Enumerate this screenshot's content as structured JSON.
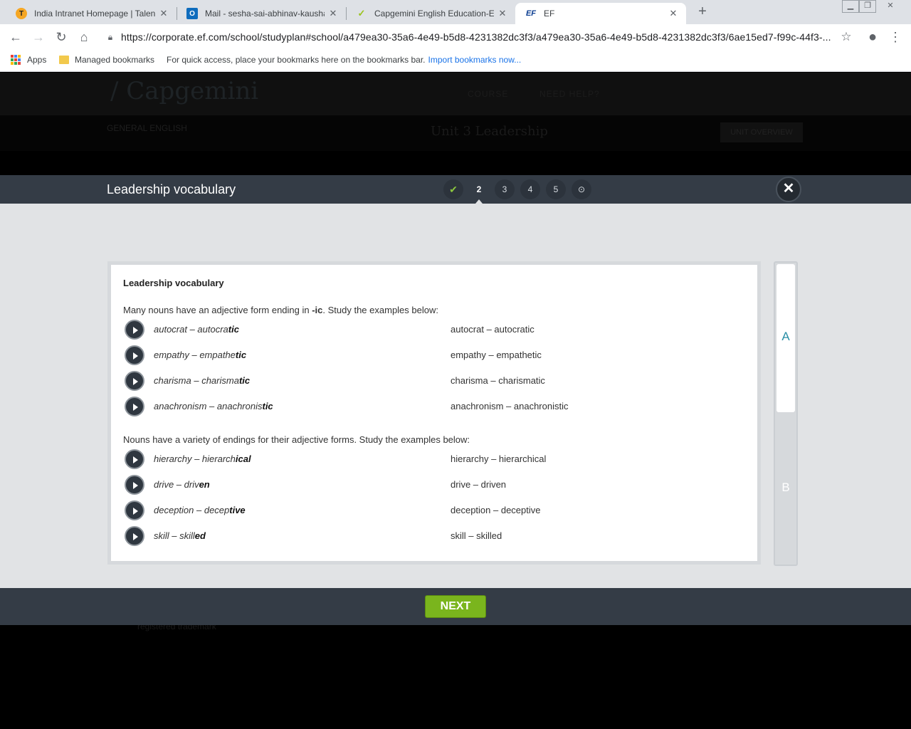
{
  "browser": {
    "tabs": [
      {
        "title": "India Intranet Homepage | Talent",
        "favicon": "talent-icon"
      },
      {
        "title": "Mail - sesha-sai-abhinav-kaushal",
        "favicon": "outlook-icon"
      },
      {
        "title": "Capgemini English Education-EF",
        "favicon": "capgemini-icon"
      },
      {
        "title": "EF",
        "favicon": "ef-icon"
      }
    ],
    "url": "https://corporate.ef.com/school/studyplan#school/a479ea30-35a6-4e49-b5d8-4231382dc3f3/a479ea30-35a6-4e49-b5d8-4231382dc3f3/6ae15ed7-f99c-44f3-...",
    "bookmarks": {
      "apps": "Apps",
      "managed": "Managed bookmarks",
      "hint": "For quick access, place your bookmarks here on the bookmarks bar.",
      "import": "Import bookmarks now..."
    }
  },
  "background_page": {
    "logo": "/ Capgemini",
    "nav": [
      "COURSE",
      "NEED HELP?"
    ],
    "course_label": "GENERAL ENGLISH",
    "unit_title": "Unit 3  Leadership",
    "overview_button": "UNIT OVERVIEW",
    "footer": "registered trademark"
  },
  "modal": {
    "title": "Leadership vocabulary",
    "steps": [
      "✔",
      "2",
      "3",
      "4",
      "5",
      "⊙"
    ],
    "current_step": "2",
    "card": {
      "title": "Leadership vocabulary",
      "intro1_pre": "Many nouns have an adjective form ending in ",
      "intro1_bold": "-ic",
      "intro1_post": ". Study the examples below:",
      "intro2": "Nouns have a variety of endings for their adjective forms. Study the examples below:",
      "group1": [
        {
          "base": "autocrat – autocra",
          "ending": "tic",
          "plain": "autocrat – autocratic"
        },
        {
          "base": "empathy – empathe",
          "ending": "tic",
          "plain": "empathy – empathetic"
        },
        {
          "base": "charisma – charisma",
          "ending": "tic",
          "plain": "charisma – charismatic"
        },
        {
          "base": "anachronism – anachronis",
          "ending": "tic",
          "plain": "anachronism – anachronistic"
        }
      ],
      "group2": [
        {
          "base": "hierarchy – hierarch",
          "ending": "ical",
          "plain": "hierarchy – hierarchical"
        },
        {
          "base": "drive – driv",
          "ending": "en",
          "plain": "drive – driven"
        },
        {
          "base": "deception – decep",
          "ending": "tive",
          "plain": "deception – deceptive"
        },
        {
          "base": "skill – skill",
          "ending": "ed",
          "plain": "skill – skilled"
        }
      ]
    },
    "side_tabs": [
      "A",
      "B"
    ],
    "next_label": "NEXT"
  }
}
